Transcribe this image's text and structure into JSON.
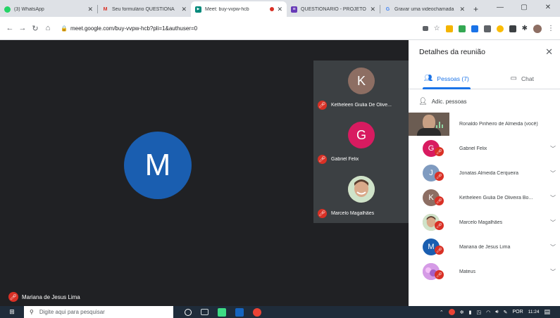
{
  "browser": {
    "tabs": [
      {
        "title": "(3) WhatsApp",
        "favicon_color": "#25d366",
        "favicon_glyph": "●"
      },
      {
        "title": "Seu formulário QUESTIONÁ",
        "favicon_color": "#ffffff",
        "favicon_glyph": "M"
      },
      {
        "title": "Meet: buy-vvpw-hcb",
        "favicon_color": "#00897b",
        "favicon_glyph": "▶"
      },
      {
        "title": "QUESTIONÁRIO - PROJETO",
        "favicon_color": "#673ab7",
        "favicon_glyph": "≡"
      },
      {
        "title": "Gravar uma videochamada",
        "favicon_color": "#ffffff",
        "favicon_glyph": "G"
      }
    ],
    "new_tab": "+",
    "url": "meet.google.com/buy-vvpw-hcb?pli=1&authuser=0"
  },
  "stage": {
    "main_initial": "M",
    "main_color": "#1a5eb0",
    "main_name": "Mariana de Jesus Lima",
    "tiles": [
      {
        "initial": "K",
        "color": "#8d6e63",
        "name": "Ketheleen Giulia De Olive..."
      },
      {
        "initial": "G",
        "color": "#d81b60",
        "name": "Gabriel Felix"
      },
      {
        "initial": "",
        "color": "#b08a6a",
        "name": "Marcelo Magalhães"
      }
    ]
  },
  "panel": {
    "title": "Detalhes da reunião",
    "tab_people": "Pessoas (7)",
    "tab_chat": "Chat",
    "add_people": "Adic. pessoas",
    "people": [
      {
        "name": "Ronaldo Pinheiro de Almeida (você)",
        "initial": "",
        "color": "#6b5c52",
        "self": true
      },
      {
        "name": "Gabriel Felix",
        "initial": "G",
        "color": "#d81b60"
      },
      {
        "name": "Jonatas Almeida Cerqueira",
        "initial": "J",
        "color": "#7f9bc0"
      },
      {
        "name": "Ketheleen Giulia De Oliveira Bo...",
        "initial": "K",
        "color": "#8d6e63"
      },
      {
        "name": "Marcelo Magalhães",
        "initial": "",
        "color": "#b08a6a"
      },
      {
        "name": "Mariana de Jesus Lima",
        "initial": "M",
        "color": "#1a5eb0"
      },
      {
        "name": "Mateus",
        "initial": "",
        "color": "#c678d8"
      }
    ]
  },
  "taskbar": {
    "search_placeholder": "Digite aqui para pesquisar",
    "language": "POR",
    "time": "11:24"
  },
  "colors": {
    "accent": "#1a73e8",
    "mic_off": "#d93025"
  }
}
